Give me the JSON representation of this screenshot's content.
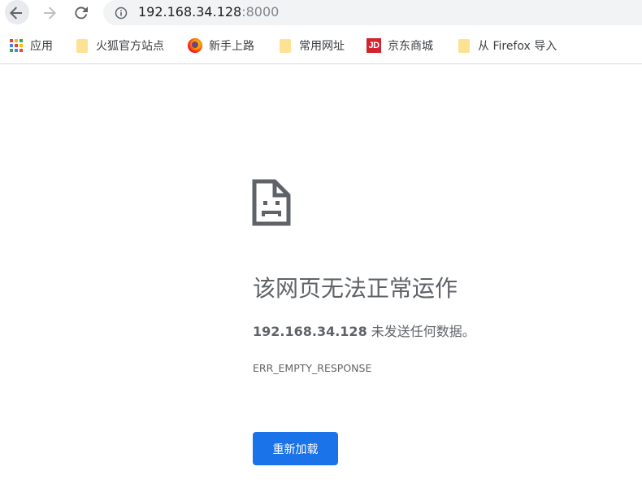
{
  "toolbar": {
    "url_host": "192.168.34.128",
    "url_port": ":8000"
  },
  "bookmarks": {
    "items": [
      {
        "label": "应用",
        "icon": "apps-grid-icon"
      },
      {
        "label": "火狐官方站点",
        "icon": "folder-icon"
      },
      {
        "label": "新手上路",
        "icon": "firefox-icon"
      },
      {
        "label": "常用网址",
        "icon": "folder-icon"
      },
      {
        "label": "京东商城",
        "icon": "jd-icon",
        "icon_text": "JD"
      },
      {
        "label": "从 Firefox 导入",
        "icon": "folder-icon"
      }
    ]
  },
  "error": {
    "icon": "sad-document-icon",
    "title": "该网页无法正常运作",
    "host": "192.168.34.128",
    "message": " 未发送任何数据。",
    "code": "ERR_EMPTY_RESPONSE",
    "reload_label": "重新加载"
  },
  "colors": {
    "accent": "#1a73e8",
    "error_text": "#5f6368",
    "omnibox_bg": "#f1f3f4",
    "folder": "#fde293",
    "jd_red": "#d1242c"
  }
}
